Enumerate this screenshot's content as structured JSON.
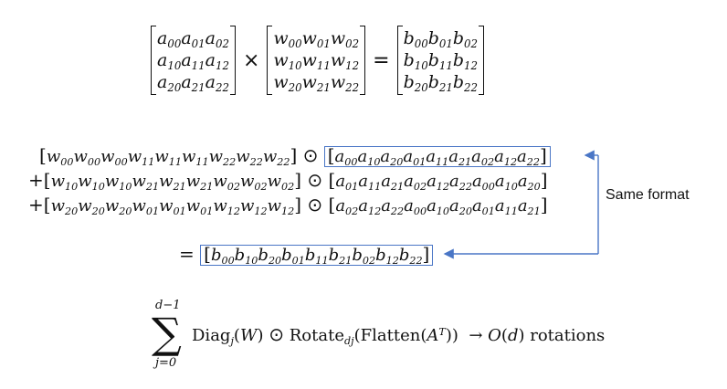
{
  "matrix_equation": {
    "A": [
      [
        "a00",
        "a01",
        "a02"
      ],
      [
        "a10",
        "a11",
        "a12"
      ],
      [
        "a20",
        "a21",
        "a22"
      ]
    ],
    "W": [
      [
        "w00",
        "w01",
        "w02"
      ],
      [
        "w10",
        "w11",
        "w12"
      ],
      [
        "w20",
        "w21",
        "w22"
      ]
    ],
    "B": [
      [
        "b00",
        "b01",
        "b02"
      ],
      [
        "b10",
        "b11",
        "b12"
      ],
      [
        "b20",
        "b21",
        "b22"
      ]
    ],
    "times": "×",
    "equals": "="
  },
  "diagonal_rows": [
    {
      "prefix": "",
      "w": [
        "00",
        "00",
        "00",
        "11",
        "11",
        "11",
        "22",
        "22",
        "22"
      ],
      "a": [
        "00",
        "10",
        "20",
        "01",
        "11",
        "21",
        "02",
        "12",
        "22"
      ],
      "boxed": true
    },
    {
      "prefix": "+",
      "w": [
        "10",
        "10",
        "10",
        "21",
        "21",
        "21",
        "02",
        "02",
        "02"
      ],
      "a": [
        "01",
        "11",
        "21",
        "02",
        "12",
        "22",
        "00",
        "10",
        "20"
      ],
      "boxed": false
    },
    {
      "prefix": "+",
      "w": [
        "20",
        "20",
        "20",
        "01",
        "01",
        "01",
        "12",
        "12",
        "12"
      ],
      "a": [
        "02",
        "12",
        "22",
        "00",
        "10",
        "20",
        "01",
        "11",
        "21"
      ],
      "boxed": false
    }
  ],
  "result_row": {
    "prefix": "=",
    "b": [
      "00",
      "10",
      "20",
      "01",
      "11",
      "21",
      "02",
      "12",
      "22"
    ]
  },
  "annotation": "Same format",
  "formula": {
    "upper": "d−1",
    "lower": "j=0",
    "text_diag": "Diag",
    "sub_j": "j",
    "W": "W",
    "rotate": "Rotate",
    "sub_dj": "dj",
    "flatten": "Flatten",
    "A": "A",
    "T": "T",
    "arrow": "→",
    "O": "O",
    "d": "d",
    "rotations": "rotations"
  },
  "colors": {
    "accent": "#4a76c6"
  }
}
